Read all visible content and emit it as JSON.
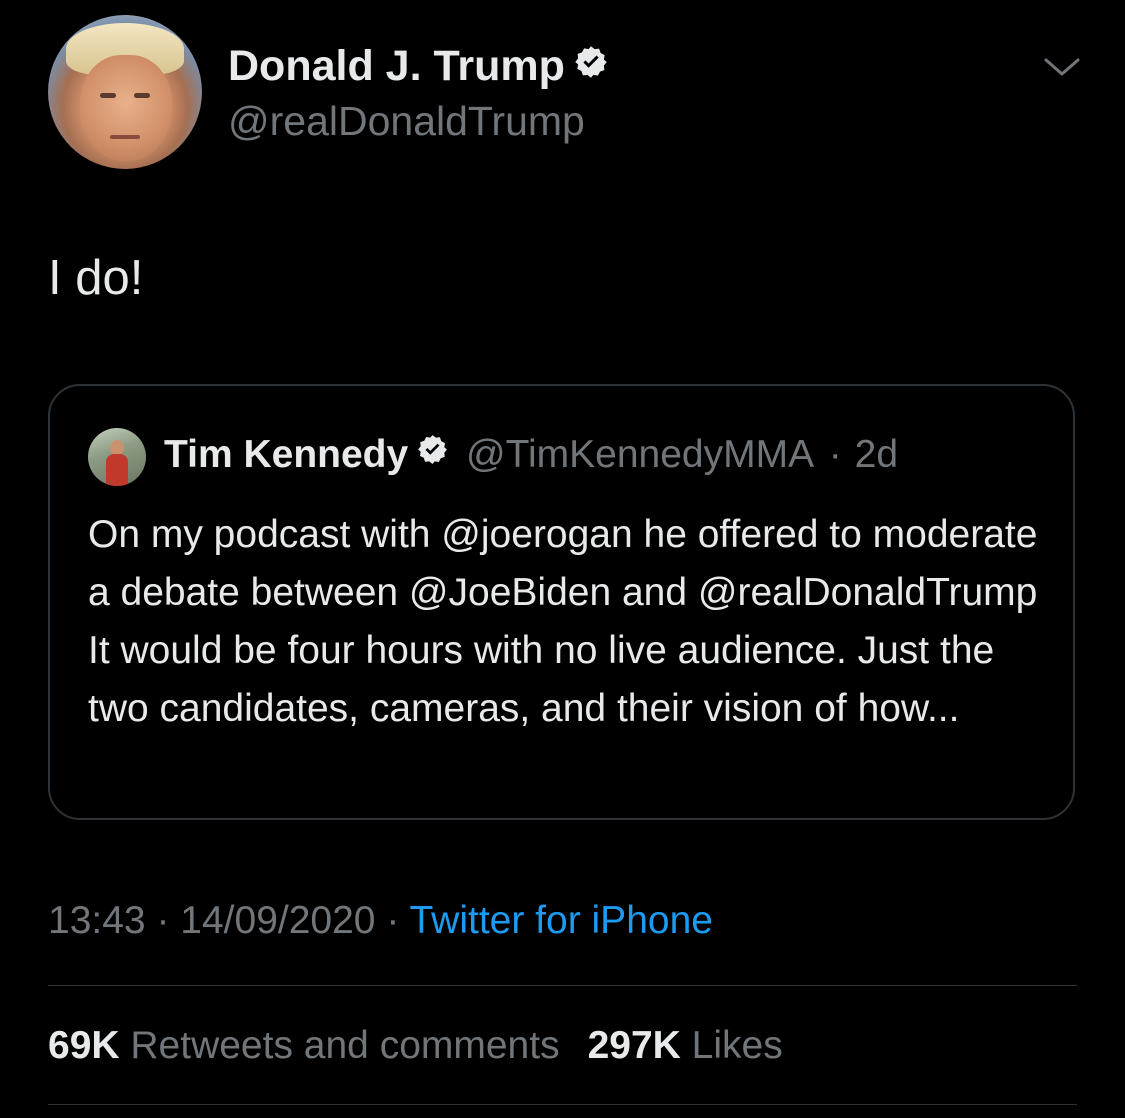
{
  "tweet": {
    "author": {
      "name": "Donald J. Trump",
      "handle": "@realDonaldTrump",
      "verified": true
    },
    "text": "I do!",
    "quoted_tweet": {
      "author_name": "Tim Kennedy",
      "author_handle": "@TimKennedyMMA",
      "verified": true,
      "separator": "·",
      "age": "2d",
      "text": "On my podcast with @joerogan he offered to moderate a debate between @JoeBiden and @realDonaldTrump It would be four hours with no live audience. Just the two candidates, cameras, and their vision of how..."
    },
    "time": "13:43",
    "date": "14/09/2020",
    "separator": "·",
    "source": "Twitter for iPhone",
    "stats": {
      "retweets_count": "69K",
      "retweets_label": "Retweets and comments",
      "likes_count": "297K",
      "likes_label": "Likes"
    }
  },
  "icons": {
    "verified": "verified-badge-icon",
    "more": "chevron-down-icon"
  },
  "colors": {
    "background": "#000000",
    "primary_text": "#e7e9ea",
    "secondary_text": "#71767b",
    "accent": "#1d9bf0",
    "border": "#2f3336"
  }
}
